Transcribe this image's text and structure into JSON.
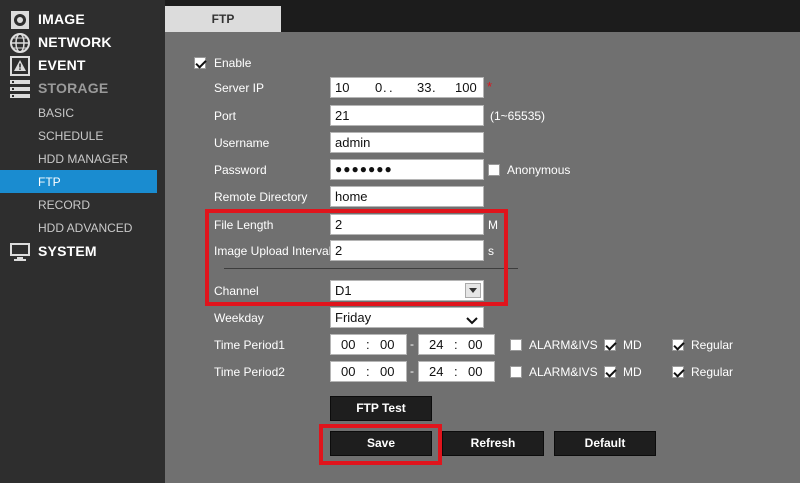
{
  "sidebar": {
    "groups": [
      {
        "label": "IMAGE",
        "icon": "camera-icon"
      },
      {
        "label": "NETWORK",
        "icon": "network-globe-icon"
      },
      {
        "label": "EVENT",
        "icon": "warning-icon"
      },
      {
        "label": "STORAGE",
        "icon": "storage-list-icon"
      },
      {
        "label": "SYSTEM",
        "icon": "monitor-icon"
      }
    ],
    "storage_items": [
      {
        "label": "BASIC"
      },
      {
        "label": "SCHEDULE"
      },
      {
        "label": "HDD MANAGER"
      },
      {
        "label": "FTP"
      },
      {
        "label": "RECORD"
      },
      {
        "label": "HDD ADVANCED"
      }
    ],
    "active_item": "FTP"
  },
  "tab": {
    "label": "FTP"
  },
  "form": {
    "enable": {
      "label": "Enable",
      "checked": true
    },
    "server_ip": {
      "label": "Server IP",
      "octets": [
        "10",
        "0",
        "33",
        "100"
      ],
      "required_mark": "*"
    },
    "port": {
      "label": "Port",
      "value": "21",
      "hint": "(1~65535)"
    },
    "username": {
      "label": "Username",
      "value": "admin"
    },
    "password": {
      "label": "Password",
      "value": "●●●●●●●"
    },
    "anonymous": {
      "label": "Anonymous",
      "checked": false
    },
    "remote_directory": {
      "label": "Remote Directory",
      "value": "home"
    },
    "file_length": {
      "label": "File Length",
      "value": "2",
      "unit": "M"
    },
    "upload_interval": {
      "label": "Image Upload Interval",
      "value": "2",
      "unit": "s"
    },
    "channel": {
      "label": "Channel",
      "value": "D1"
    },
    "weekday": {
      "label": "Weekday",
      "value": "Friday"
    },
    "periods": [
      {
        "label": "Time Period1",
        "start_h": "00",
        "start_m": "00",
        "dash": "-",
        "end_h": "24",
        "end_m": "00",
        "alarm": {
          "label": "ALARM&IVS",
          "checked": false
        },
        "md": {
          "label": "MD",
          "checked": true
        },
        "regular": {
          "label": "Regular",
          "checked": true
        }
      },
      {
        "label": "Time Period2",
        "start_h": "00",
        "start_m": "00",
        "dash": "-",
        "end_h": "24",
        "end_m": "00",
        "alarm": {
          "label": "ALARM&IVS",
          "checked": false
        },
        "md": {
          "label": "MD",
          "checked": true
        },
        "regular": {
          "label": "Regular",
          "checked": true
        }
      }
    ]
  },
  "buttons": {
    "ftp_test": "FTP Test",
    "save": "Save",
    "refresh": "Refresh",
    "default": "Default"
  },
  "colors": {
    "active": "#1a8cd0",
    "highlight": "#e0141c",
    "panel": "#707070"
  }
}
